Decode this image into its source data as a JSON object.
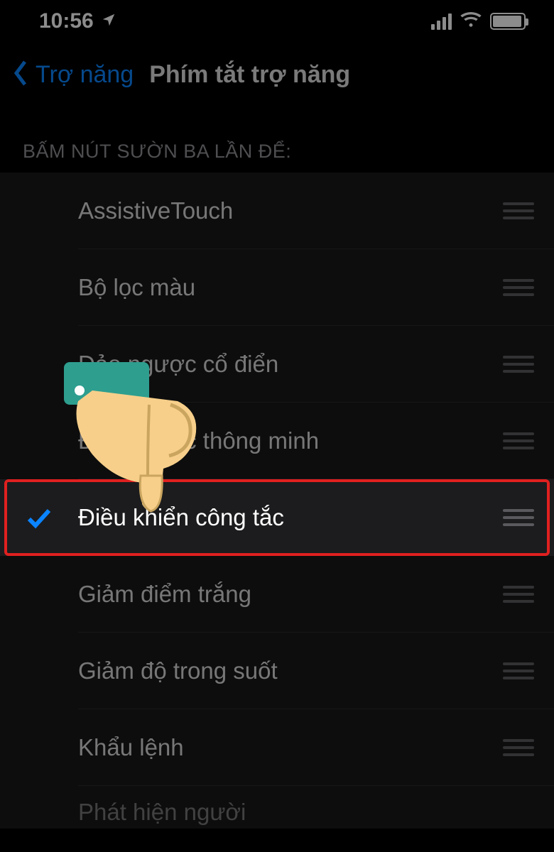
{
  "status": {
    "time": "10:56"
  },
  "nav": {
    "back_label": "Trợ năng",
    "title": "Phím tắt trợ năng"
  },
  "section_header": "BẤM NÚT SƯỜN BA LẦN ĐỂ:",
  "items": [
    {
      "label": "AssistiveTouch",
      "checked": false,
      "highlighted": false
    },
    {
      "label": "Bộ lọc màu",
      "checked": false,
      "highlighted": false
    },
    {
      "label": "Đảo ngược cổ điển",
      "checked": false,
      "highlighted": false
    },
    {
      "label": "Đảo ngược thông minh",
      "checked": false,
      "highlighted": false
    },
    {
      "label": "Điều khiển công tắc",
      "checked": true,
      "highlighted": true
    },
    {
      "label": "Giảm điểm trắng",
      "checked": false,
      "highlighted": false
    },
    {
      "label": "Giảm độ trong suốt",
      "checked": false,
      "highlighted": false
    },
    {
      "label": "Khẩu lệnh",
      "checked": false,
      "highlighted": false
    }
  ],
  "cutoff_label": "Phát hiện người"
}
